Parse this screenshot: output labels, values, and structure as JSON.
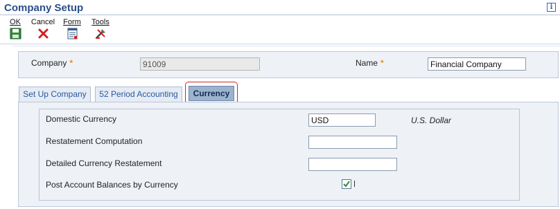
{
  "window": {
    "title": "Company Setup",
    "info_icon": "info-icon"
  },
  "toolbar": {
    "ok_label": "OK",
    "cancel_label": "Cancel",
    "form_label": "Form",
    "tools_label": "Tools",
    "icons": {
      "ok": "save-disk-icon",
      "cancel": "red-x-icon",
      "form": "form-icon",
      "tools": "tools-icon"
    }
  },
  "header": {
    "company_label": "Company",
    "company_value": "91009",
    "name_label": "Name",
    "name_value": "Financial Company",
    "required_marker": "*"
  },
  "tabs": [
    {
      "label": "Set Up Company",
      "active": false
    },
    {
      "label": "52 Period Accounting",
      "active": false
    },
    {
      "label": "Currency",
      "active": true
    }
  ],
  "currency": {
    "domestic_currency_label": "Domestic Currency",
    "domestic_currency_value": "USD",
    "domestic_currency_desc": "U.S. Dollar",
    "restatement_computation_label": "Restatement Computation",
    "restatement_computation_value": "",
    "detailed_restatement_label": "Detailed Currency Restatement",
    "detailed_restatement_value": "",
    "post_balances_label": "Post Account Balances by Currency",
    "post_balances_checked": true
  },
  "colors": {
    "title": "#2a4f8a",
    "required": "#f08c1a",
    "active_tab": "#9db3cd",
    "highlight": "#d82020"
  }
}
